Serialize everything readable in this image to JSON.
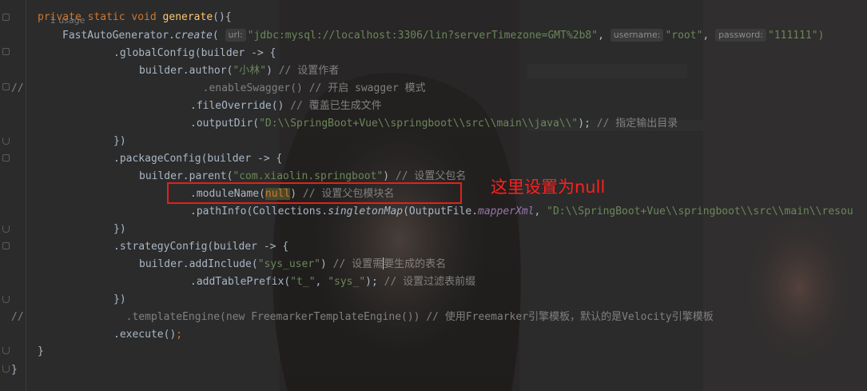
{
  "editor": {
    "usage_hint": "1 usage",
    "lines": {
      "signature": {
        "kw": "private static void ",
        "name": "generate",
        "rest": "(){"
      },
      "create": {
        "cls": "FastAutoGenerator.",
        "method": "create",
        "open": "(",
        "url_hint": "url:",
        "url": "\"jdbc:mysql://localhost:3306/lin?serverTimezone=GMT%2b8\"",
        "user_hint": "username:",
        "user": "\"root\"",
        "pass_hint": "password:",
        "pass": "\"111111\")"
      },
      "global_config": ".globalConfig(builder -> {",
      "author": {
        "code": "builder.author(",
        "str": "\"小林\"",
        "close": ")",
        "comment": " // 设置作者"
      },
      "swagger": {
        "prefix": "//",
        "code": ".enableSwagger()",
        "comment": " // 开启 swagger 模式"
      },
      "file_override": {
        "code": ".fileOverride()",
        "comment": " // 覆盖已生成文件"
      },
      "output_dir": {
        "code": ".outputDir(",
        "str": "\"D:\\\\SpringBoot+Vue\\\\springboot\\\\src\\\\main\\\\java\\\\\"",
        "close": ");",
        "comment": " // 指定输出目录"
      },
      "close1": "})",
      "package_config": ".packageConfig(builder -> {",
      "parent": {
        "code": "builder.parent(",
        "str": "\"com.xiaolin.springboot\"",
        "close": ")",
        "comment": " // 设置父包名"
      },
      "module_name": {
        "code": ".moduleName(",
        "kw": "null",
        "close": ")",
        "comment": " // 设置父包模块名"
      },
      "path_info": {
        "code": ".pathInfo(Collections.",
        "method": "singletonMap",
        "open": "(OutputFile.",
        "field": "mapperXml",
        "sep": ", ",
        "str": "\"D:\\\\SpringBoot+Vue\\\\springboot\\\\src\\\\main\\\\resou"
      },
      "close2": "})",
      "strategy_config": ".strategyConfig(builder -> {",
      "add_include": {
        "code": "builder.addInclude(",
        "str": "\"sys_user\"",
        "close": ")",
        "comment_a": " // 设置需",
        "comment_b": "要生成的表名"
      },
      "table_prefix": {
        "code": ".addTablePrefix(",
        "str1": "\"t_\"",
        "sep": ", ",
        "str2": "\"sys_\"",
        "close": ");",
        "comment": " // 设置过滤表前缀"
      },
      "close3": "})",
      "template": {
        "prefix": "//",
        "code": ".templateEngine(new FreemarkerTemplateEngine())",
        "comment": " // 使用Freemarker引擎模板，默认的是Velocity引擎模板"
      },
      "execute": {
        "code": ".execute()",
        "semi": ";"
      },
      "brace1": "}",
      "brace2": "}"
    }
  },
  "annotation": {
    "text": "这里设置为null",
    "color": "#ff1f1f"
  },
  "colors": {
    "background": "#2b2b2b",
    "keyword": "#cc7832",
    "string": "#6a8759",
    "comment": "#808080",
    "method_decl": "#ffc66d",
    "static_field": "#9876aa"
  }
}
